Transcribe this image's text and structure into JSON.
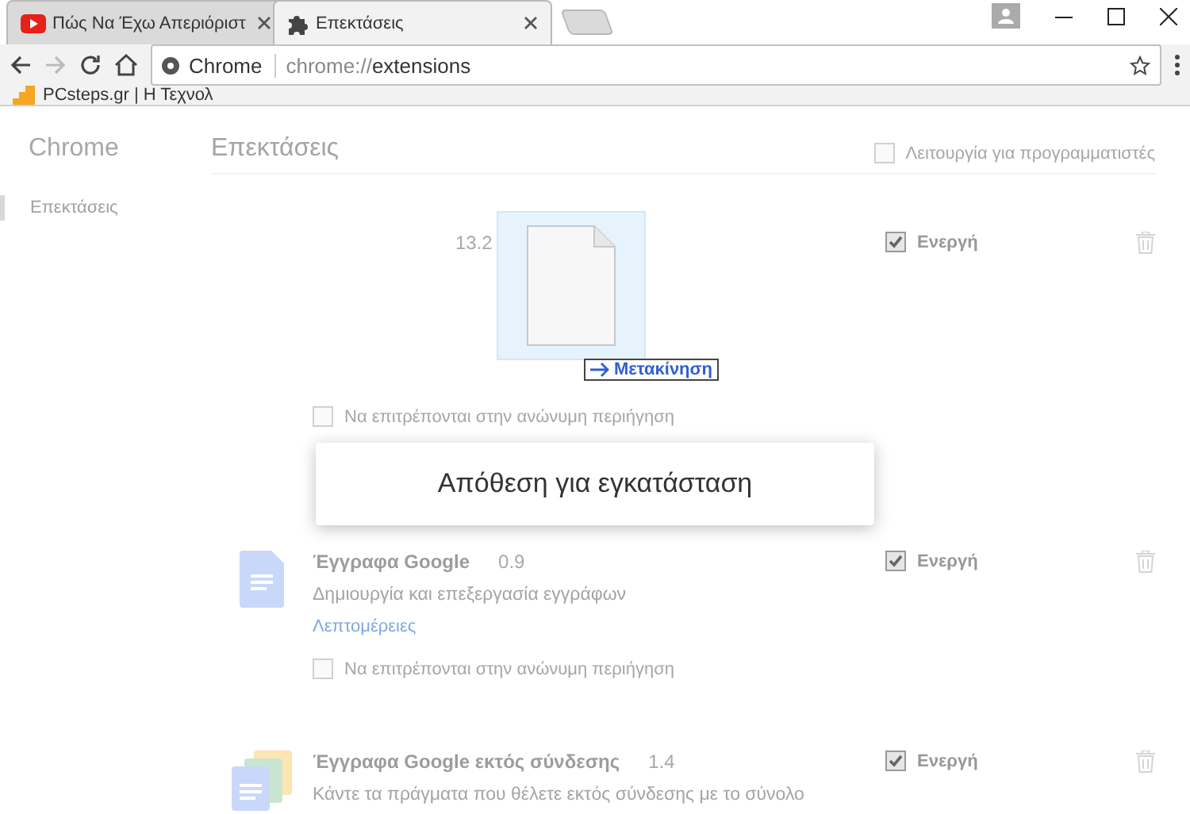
{
  "tabs": [
    {
      "title": "Πώς Να Έχω Απεριόριστ",
      "kind": "video",
      "selected": false
    },
    {
      "title": "Επεκτάσεις",
      "kind": "puzzle",
      "selected": true
    }
  ],
  "toolbar": {
    "origin": "Chrome",
    "url_scheme": "chrome://",
    "url_path": "extensions"
  },
  "bookmarks": [
    {
      "label": "PCsteps.gr | Η Τεχνολ"
    }
  ],
  "sidebar": {
    "title": "Chrome",
    "items": [
      {
        "label": "Επεκτάσεις",
        "selected": true
      }
    ]
  },
  "page": {
    "title": "Επεκτάσεις",
    "developer_mode": {
      "label": "Λειτουργία για προγραμματιστές",
      "checked": false
    }
  },
  "extensions": [
    {
      "kind": "hidden",
      "version": "13.2",
      "enabled": {
        "label": "Ενεργή",
        "checked": true
      },
      "incognito": {
        "label": "Να επιτρέπονται στην ανώνυμη περιήγηση",
        "checked": false
      }
    },
    {
      "kind": "docs",
      "name": "Έγγραφα Google",
      "version": "0.9",
      "description": "Δημιουργία και επεξεργασία εγγράφων",
      "link": "Λεπτομέρειες",
      "enabled": {
        "label": "Ενεργή",
        "checked": true
      },
      "incognito": {
        "label": "Να επιτρέπονται στην ανώνυμη περιήγηση",
        "checked": false
      }
    },
    {
      "kind": "offline",
      "name": "Έγγραφα Google εκτός σύνδεσης",
      "version": "1.4",
      "description": "Κάντε τα πράγματα που θέλετε εκτός σύνδεσης με το σύνολο",
      "enabled": {
        "label": "Ενεργή",
        "checked": true
      }
    }
  ],
  "drag": {
    "action": "Μετακίνηση"
  },
  "drop_zone": {
    "label": "Απόθεση για εγκατάσταση"
  }
}
